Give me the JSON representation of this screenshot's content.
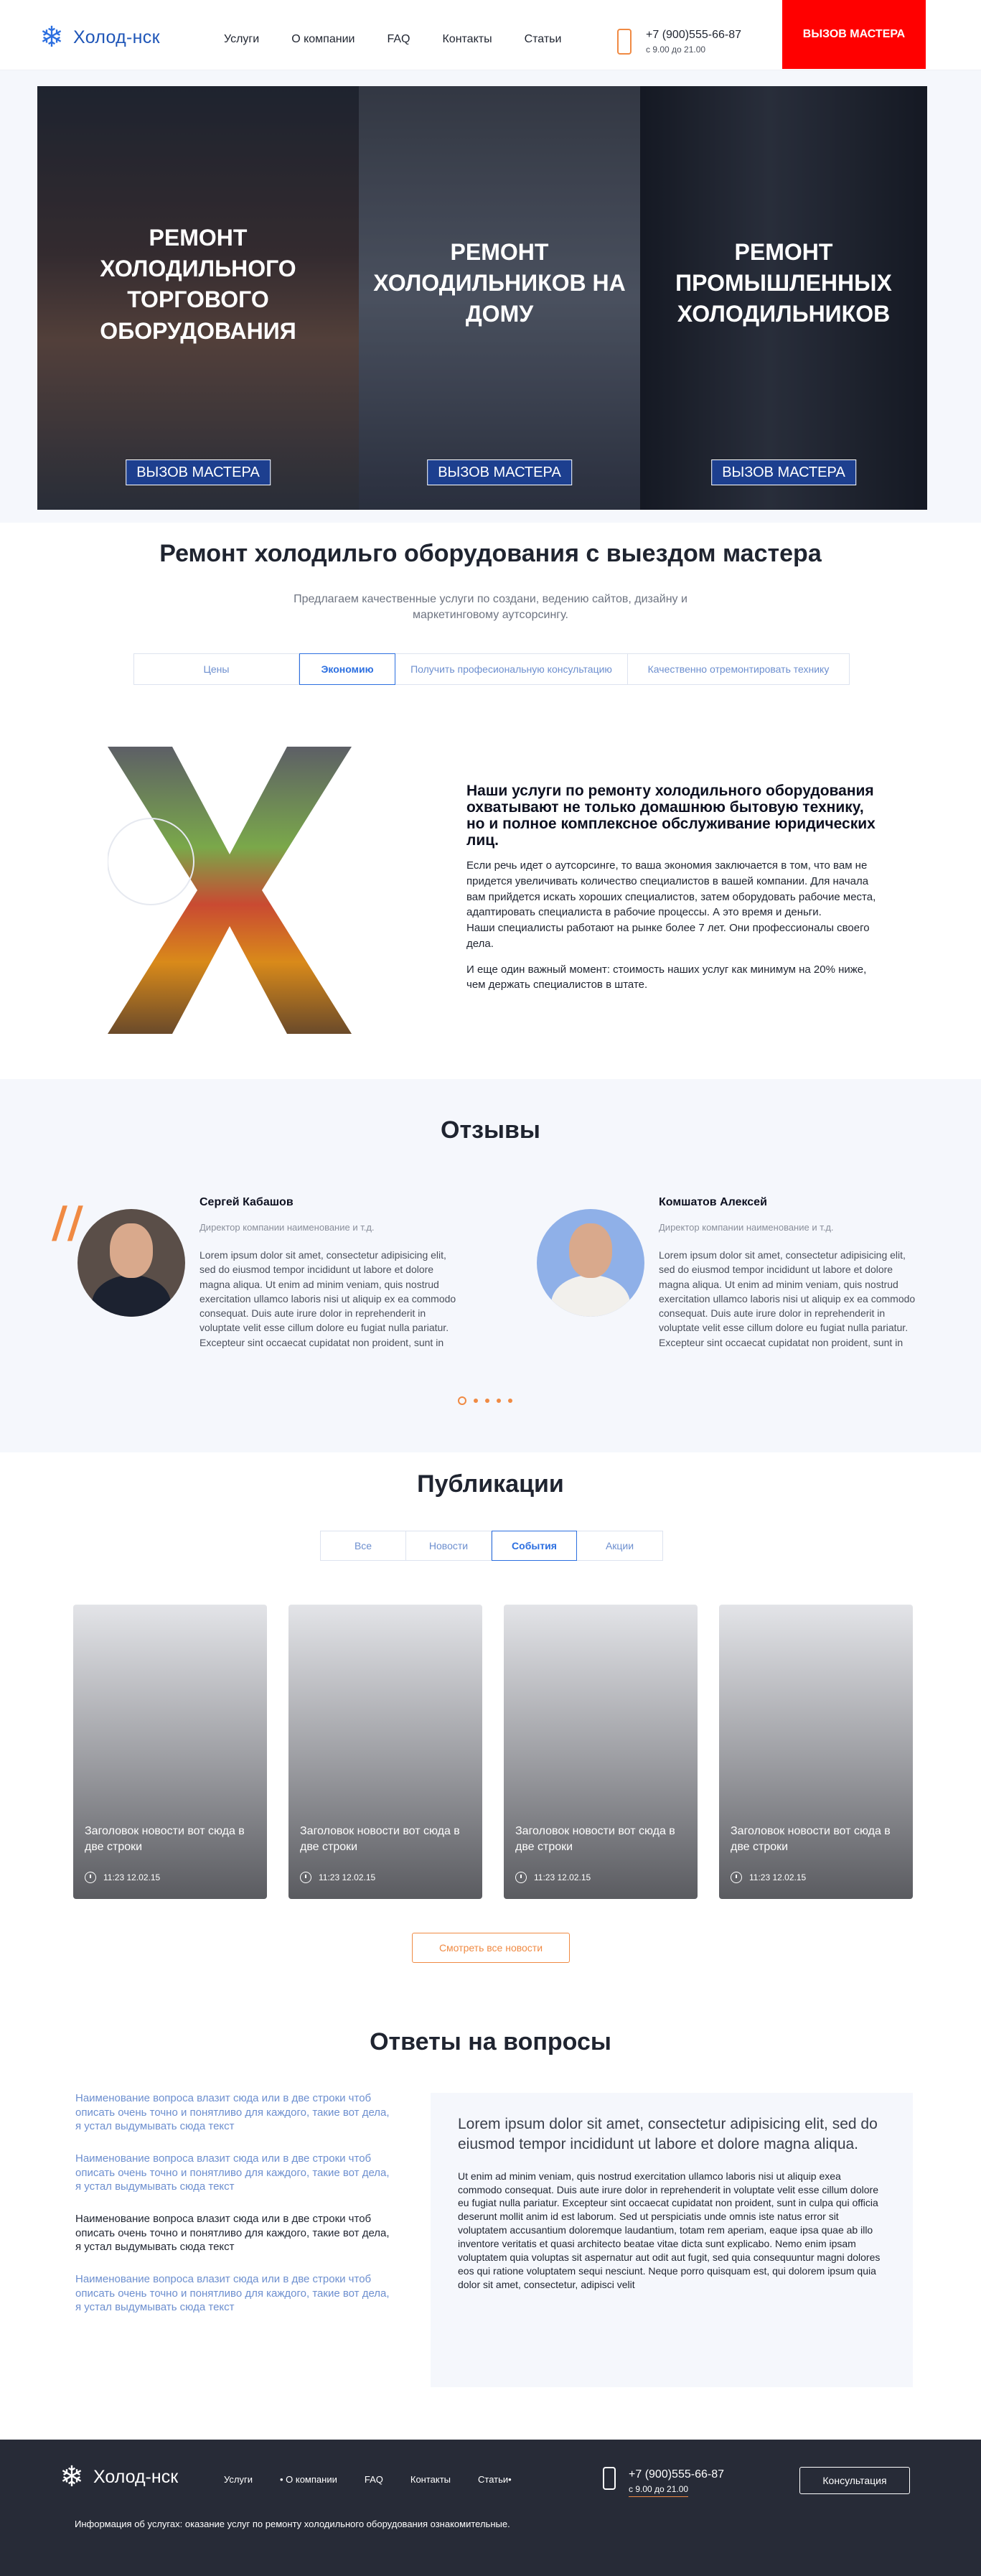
{
  "header": {
    "logo_text": "Холод-нск",
    "nav": [
      "Услуги",
      "О компании",
      "FAQ",
      "Контакты",
      "Статьи"
    ],
    "phone": "+7 (900)555-66-87",
    "hours": "с 9.00 до 21.00",
    "cta": "ВЫЗОВ МАСТЕРА"
  },
  "hero": {
    "cards": [
      {
        "title": "РЕМОНТ ХОЛОДИЛЬНОГО ТОРГОВОГО ОБОРУДОВАНИЯ",
        "button": "ВЫЗОВ МАСТЕРА"
      },
      {
        "title": "РЕМОНТ ХОЛОДИЛЬНИКОВ НА ДОМУ",
        "button": "ВЫЗОВ МАСТЕРА"
      },
      {
        "title": "РЕМОНТ ПРОМЫШЛЕННЫХ ХОЛОДИЛЬНИКОВ",
        "button": "ВЫЗОВ МАСТЕРА"
      }
    ]
  },
  "intro": {
    "title": "Ремонт холодильго оборудования с выездом мастера",
    "subtitle": "Предлагаем качественные услуги по создани, ведению сайтов, дизайну и маркетинговому аутсорсингу.",
    "tabs": [
      "Цены",
      "Экономию",
      "Получить професиональную консультацию",
      "Качественно отремонтировать технику"
    ],
    "active_tab": 1
  },
  "services": {
    "heading": "Наши услуги по ремонту холодильного оборудования охватывают не только домашнюю бытовую технику, но и полное комплексное обслуживание юридических лиц.",
    "paragraph1": "Если речь идет о аутсорсинге, то ваша экономия заключается в том, что вам не придется увеличивать количество специалистов в вашей компании. Для начала вам прийдется искать хороших специалистов, затем оборудовать рабочие места, адаптировать специалиста в рабочие процессы. А это время и деньги.",
    "paragraph2": "Наши специалисты работают на рынке более 7 лет. Они профессионалы своего дела.",
    "paragraph3": "И еще один важный момент: стоимость наших услуг как минимум на 20% ниже, чем держать специалистов в штате."
  },
  "reviews": {
    "title": "Отзывы",
    "quote_mark": "//",
    "items": [
      {
        "name": "Сергей Кабашов",
        "role": "Директор компании наименование и т.д.",
        "text": "Lorem ipsum dolor sit amet, consectetur adipisicing elit, sed do eiusmod tempor incididunt ut labore et dolore magna aliqua. Ut enim ad minim veniam, quis nostrud exercitation ullamco laboris nisi ut aliquip ex ea commodo consequat. Duis aute irure dolor in reprehenderit in voluptate velit esse cillum dolore eu fugiat nulla pariatur. Excepteur sint occaecat cupidatat non proident, sunt in"
      },
      {
        "name": "Комшатов Алексей",
        "role": "Директор компании наименование и т.д.",
        "text": "Lorem ipsum dolor sit amet, consectetur adipisicing elit, sed do eiusmod tempor incididunt ut labore et dolore magna aliqua. Ut enim ad minim veniam, quis nostrud exercitation ullamco laboris nisi ut aliquip ex ea commodo consequat. Duis aute irure dolor in reprehenderit in voluptate velit esse cillum dolore eu fugiat nulla pariatur. Excepteur sint occaecat cupidatat non proident, sunt in"
      }
    ],
    "pagination_count": 5,
    "pagination_active": 1
  },
  "publications": {
    "title": "Публикации",
    "tabs": [
      "Все",
      "Новости",
      "События",
      "Акции"
    ],
    "active_tab": 3,
    "items": [
      {
        "title": "Заголовок новости вот сюда в две строки",
        "date": "11:23 12.02.15"
      },
      {
        "title": "Заголовок новости вот сюда в две строки",
        "date": "11:23 12.02.15"
      },
      {
        "title": "Заголовок новости вот сюда в две строки",
        "date": "11:23 12.02.15"
      },
      {
        "title": "Заголовок новости вот сюда в две строки",
        "date": "11:23 12.02.15"
      }
    ],
    "all_button": "Смотреть все новости"
  },
  "faq": {
    "title": "Ответы на вопросы",
    "questions": [
      "Наименование вопроса влазит сюда или в две строки чтоб описать очень точно и понятливо для каждого, такие вот дела, я устал выдумывать сюда текст",
      "Наименование вопроса влазит сюда или в две строки чтоб описать очень точно и понятливо для каждого, такие вот дела, я устал выдумывать сюда текст",
      "Наименование вопроса влазит сюда или в две строки чтоб описать очень точно и понятливо для каждого, такие вот дела, я устал выдумывать сюда текст",
      "Наименование вопроса влазит сюда или в две строки чтоб описать очень точно и понятливо для каждого, такие вот дела, я устал выдумывать сюда текст"
    ],
    "active_question": 3,
    "answer_heading": "Lorem ipsum dolor sit amet, consectetur adipisicing elit, sed do eiusmod tempor incididunt ut labore et dolore magna aliqua.",
    "answer_body": "Ut enim ad minim veniam, quis nostrud exercitation ullamco laboris nisi ut aliquip exea commodo consequat. Duis aute irure dolor in reprehenderit in voluptate velit esse cillum dolore eu fugiat nulla pariatur. Excepteur sint occaecat cupidatat non proident, sunt in culpa qui officia deserunt mollit anim id est laborum. Sed ut perspiciatis unde omnis iste natus error sit voluptatem accusantium doloremque laudantium, totam rem aperiam, eaque ipsa quae ab illo inventore veritatis et quasi architecto beatae vitae dicta sunt explicabo. Nemo enim ipsam voluptatem quia voluptas sit aspernatur aut odit aut fugit, sed quia consequuntur magni dolores eos qui ratione voluptatem sequi nesciunt. Neque porro quisquam est, qui dolorem ipsum quia dolor sit amet, consectetur, adipisci velit"
  },
  "footer": {
    "logo_text": "Холод-нск",
    "nav": [
      "Услуги",
      "• О компании",
      "FAQ",
      "Контакты",
      "Статьи•"
    ],
    "phone": "+7 (900)555-66-87",
    "hours": "с 9.00 до 21.00",
    "consult_button": "Консультация",
    "info": "Информация об услугах: оказание услуг по ремонту холодильного оборудования ознакомительные."
  },
  "colors": {
    "accent_red": "#ff0000",
    "accent_orange": "#f08a43",
    "link_blue": "#6d8fcf",
    "brand_blue": "#2c6fe0",
    "footer_bg": "#272b37"
  }
}
